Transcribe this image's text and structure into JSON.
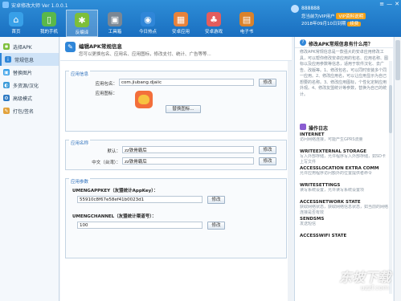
{
  "app": {
    "title": "安卓修改大师 Ver 1.0.0.1"
  },
  "toolbar": [
    {
      "label": "首页",
      "icon": "home-icon",
      "color": "#38a0e8"
    },
    {
      "label": "我的手机",
      "icon": "phone-icon",
      "color": "#5ab84a"
    },
    {
      "label": "反编译",
      "icon": "android-icon",
      "color": "#7dbf3a"
    },
    {
      "label": "工具箱",
      "icon": "toolbox-icon",
      "color": "#7a8794"
    },
    {
      "label": "今日热点",
      "icon": "globe-icon",
      "color": "#2f86d8"
    },
    {
      "label": "安卓应用",
      "icon": "apps-icon",
      "color": "#e8823a"
    },
    {
      "label": "安卓游戏",
      "icon": "game-icon",
      "color": "#e35d5d"
    },
    {
      "label": "电子书",
      "icon": "book-icon",
      "color": "#d9822b"
    }
  ],
  "user": {
    "name": "888888",
    "vip_text": "您当前为VIP用户",
    "vip_button": "VIP资料说明",
    "expiry_text": "2018年09月10日到期",
    "renew_label": "续费"
  },
  "sidebar": {
    "items": [
      {
        "label": "选择APK",
        "icon": "android-small-icon",
        "color": "#7dbf3a"
      },
      {
        "label": "常规信息",
        "icon": "info-icon",
        "color": "#2f86d8"
      },
      {
        "label": "替换图片",
        "icon": "image-icon",
        "color": "#38a0e8"
      },
      {
        "label": "多资源/汉化",
        "icon": "language-icon",
        "color": "#3c9bd9"
      },
      {
        "label": "高级模式",
        "icon": "advanced-icon",
        "color": "#2b78c2"
      },
      {
        "label": "打包/签名",
        "icon": "package-icon",
        "color": "#e2a23b"
      }
    ]
  },
  "main": {
    "header_title": "编辑APK常规信息",
    "header_desc": "您可以更换包名、应用名、应用图标，修改支付、统计、广告等等...",
    "app_info": {
      "section_title": "应用信息",
      "package_label": "应用包名：",
      "package_value": "com.jiubang.djaiic",
      "modify_label": "修改",
      "icon_label": "应用图标：",
      "replace_icon_label": "替换图标..."
    },
    "app_name": {
      "section_title": "应用名称",
      "default_label": "默认：",
      "default_value": "zz铁骨霸后",
      "cn_label": "中文（台湾）：",
      "cn_value": "zz铁骨霸后",
      "modify_label": "修改"
    },
    "params": {
      "section_title": "应用参数",
      "appkey_label": "UMENGAPPKEY（友盟统计AppKey）：",
      "appkey_value": "55910c8f67e58ef41b0023d1",
      "channel_label": "UMENGCHANNEL（友盟统计渠道号）：",
      "channel_value": "100",
      "modify_label": "修改"
    }
  },
  "right": {
    "faq_title": "修改APK常规信息有什么用？",
    "faq_text": "修改APK常规信息是一款强大的安卓应用修改工具，可以帮你修改安卓应用的包名、应用名称、图标以及应用参数等信息，适用于软件汉化、去广告、改版等。1、修改包名，可以同时安装多个同一应用。2、修改应用名，可以让应用显示为自己想要的名称。3、修改应用图标，个性化定制应用外观。4、修改友盟统计等参数，替换为自己的统计。",
    "log_title": "操作日志",
    "permissions": [
      {
        "name": "INTERNET",
        "desc": "访问网络连接，可能产生GPRS流量"
      },
      {
        "name": "WRITEEXTERNAL STORAGE",
        "desc": "写入外部存储，允许程序写入外部存储，如SD卡上写文件"
      },
      {
        "name": "ACCESSLOCATION EXTRA COMM",
        "desc": "允许应用程序访问额外的位置提供者命令"
      },
      {
        "name": "WRITESETTINGS",
        "desc": "读写系统设置，允许读写系统设置项"
      },
      {
        "name": "ACCESSNETWORK STATE",
        "desc": "获取网络状态，获取网络信息状态，如当前的网络连接是否有效"
      },
      {
        "name": "SENDSMS",
        "desc": "发送短信"
      },
      {
        "name": "ACCESSWIFI STATE",
        "desc": ""
      }
    ]
  },
  "watermark": {
    "text": "东坡下载",
    "sub": "uzzf.com"
  }
}
